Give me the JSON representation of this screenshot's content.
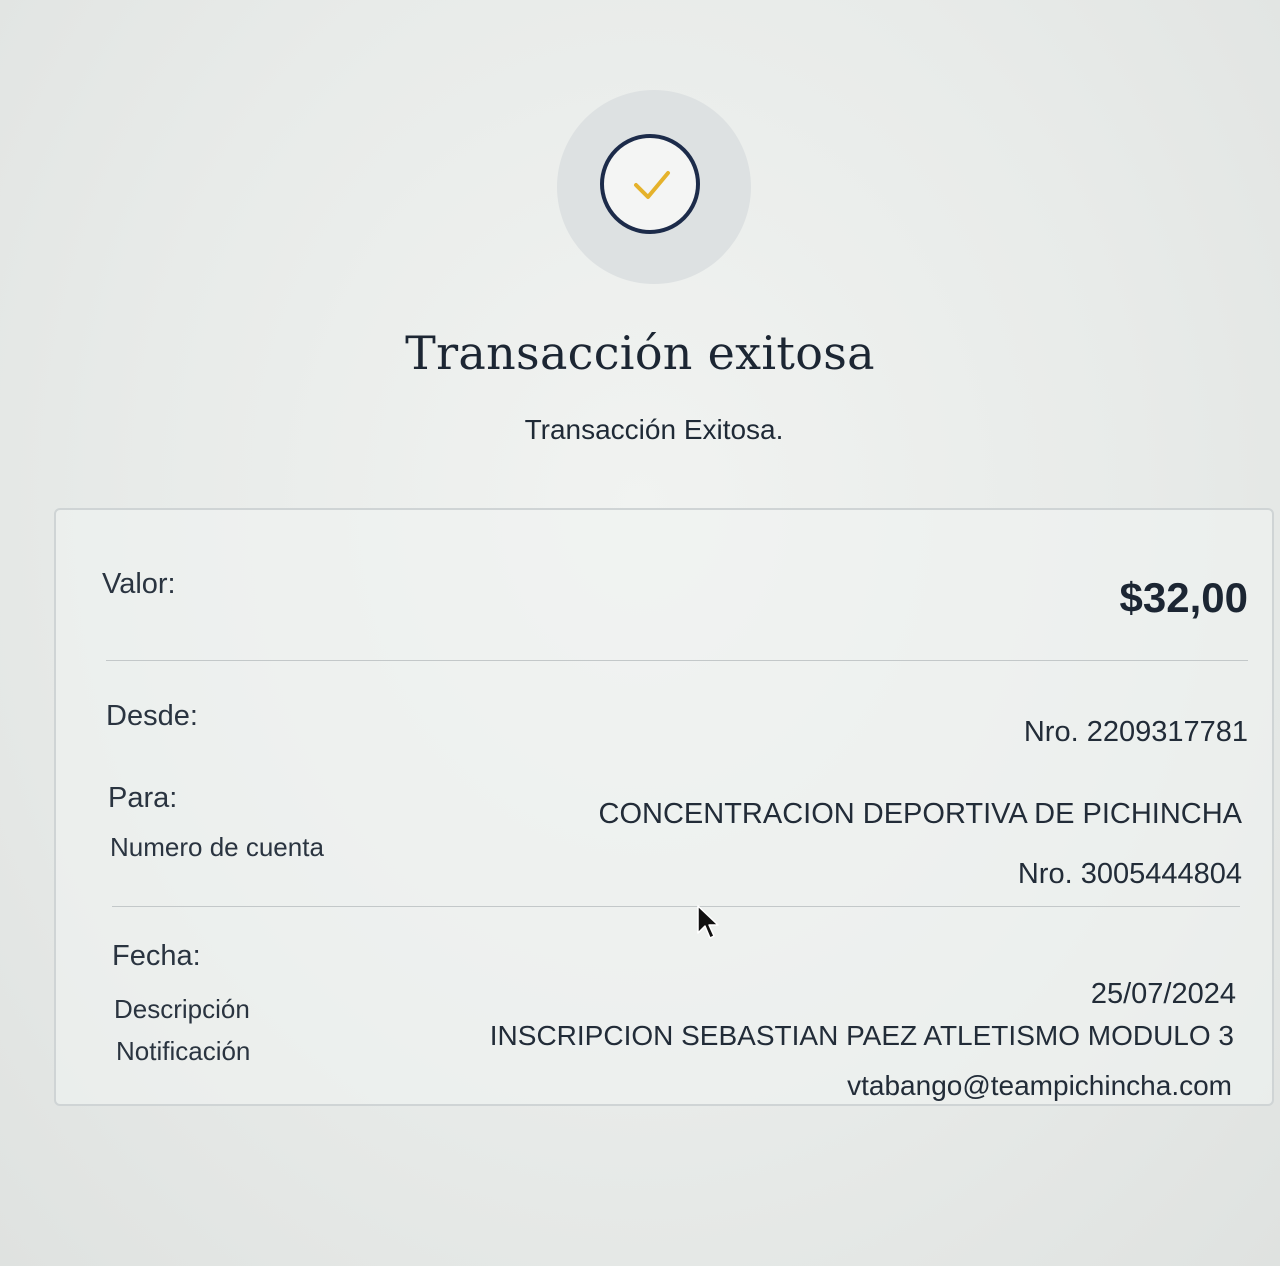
{
  "header": {
    "title": "Transacción exitosa",
    "subtitle": "Transacción Exitosa."
  },
  "icons": {
    "success": "check-circle-icon",
    "pointer": "mouse-cursor-icon"
  },
  "colors": {
    "check_mark": "#e5b22b",
    "circle_border": "#1c2b4a"
  },
  "details": {
    "valor_label": "Valor:",
    "valor_value": "$32,00",
    "desde_label": "Desde:",
    "desde_value": "Nro. 2209317781",
    "para_label": "Para:",
    "para_value": "CONCENTRACION DEPORTIVA DE PICHINCHA",
    "cuenta_label": "Numero de cuenta",
    "cuenta_value": "Nro. 3005444804",
    "fecha_label": "Fecha:",
    "fecha_value": "25/07/2024",
    "descripcion_label": "Descripción",
    "descripcion_value": "INSCRIPCION SEBASTIAN PAEZ ATLETISMO MODULO 3",
    "notificacion_label": "Notificación",
    "notificacion_value": "vtabango@teampichincha.com"
  }
}
